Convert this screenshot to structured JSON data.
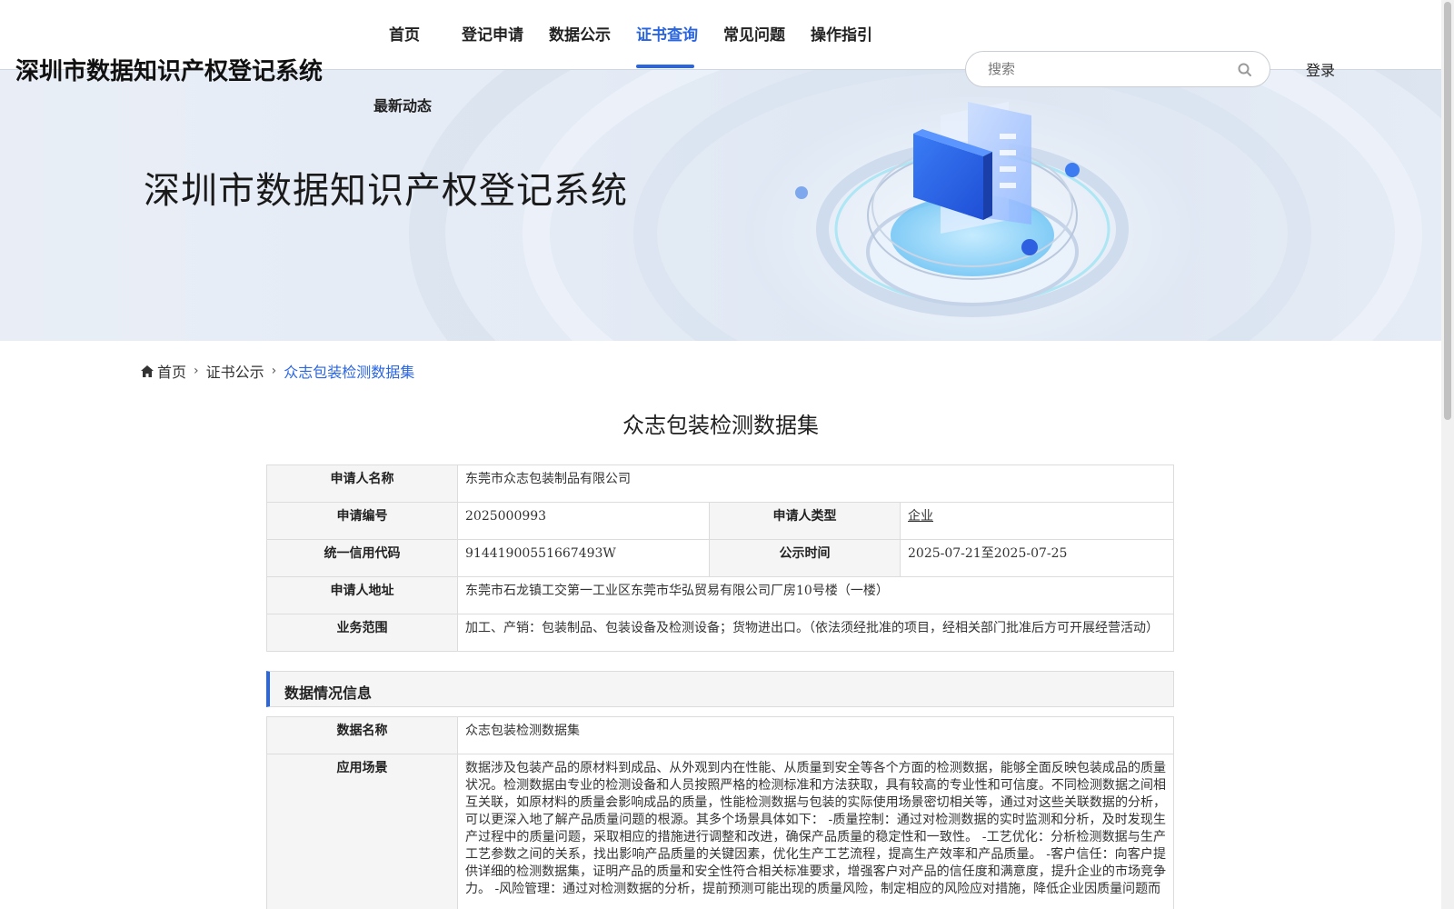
{
  "header": {
    "site_title": "深圳市数据知识产权登记系统",
    "nav": [
      {
        "label": "首页"
      },
      {
        "label": "登记申请"
      },
      {
        "label": "数据公示"
      },
      {
        "label": "证书查询",
        "active": true
      },
      {
        "label": "常见问题"
      },
      {
        "label": "操作指引"
      }
    ],
    "nav_second_row": "最新动态",
    "search_placeholder": "搜索",
    "login_label": "登录",
    "accent_color": "#2a66e0"
  },
  "banner": {
    "title": "深圳市数据知识产权登记系统"
  },
  "breadcrumb": {
    "home": "首页",
    "level2": "证书公示",
    "current": "众志包装检测数据集"
  },
  "page_title": "众志包装检测数据集",
  "applicant": {
    "name_label": "申请人名称",
    "name_value": "东莞市众志包装制品有限公司",
    "number_label": "申请编号",
    "number_value": "2025000993",
    "type_label": "申请人类型",
    "type_value": "企业",
    "credit_label": "统一信用代码",
    "credit_value": "91441900551667493W",
    "publish_label": "公示时间",
    "publish_value": "2025-07-21至2025-07-25",
    "address_label": "申请人地址",
    "address_value": "东莞市石龙镇工交第一工业区东莞市华弘贸易有限公司厂房10号楼（一楼）",
    "scope_label": "业务范围",
    "scope_value": "加工、产销：包装制品、包装设备及检测设备；货物进出口。（依法须经批准的项目，经相关部门批准后方可开展经营活动）"
  },
  "data_section": {
    "heading": "数据情况信息",
    "data_name_label": "数据名称",
    "data_name_value": "众志包装检测数据集",
    "scenario_label": "应用场景",
    "scenario_value": "数据涉及包装产品的原材料到成品、从外观到内在性能、从质量到安全等各个方面的检测数据，能够全面反映包装成品的质量状况。检测数据由专业的检测设备和人员按照严格的检测标准和方法获取，具有较高的专业性和可信度。不同检测数据之间相互关联，如原材料的质量会影响成品的质量，性能检测数据与包装的实际使用场景密切相关等，通过对这些关联数据的分析，可以更深入地了解产品质量问题的根源。其多个场景具体如下： -质量控制：通过对检测数据的实时监测和分析，及时发现生产过程中的质量问题，采取相应的措施进行调整和改进，确保产品质量的稳定性和一致性。 -工艺优化：分析检测数据与生产工艺参数之间的关系，找出影响产品质量的关键因素，优化生产工艺流程，提高生产效率和产品质量。 -客户信任：向客户提供详细的检测数据集，证明产品的质量和安全性符合相关标准要求，增强客户对产品的信任度和满意度，提升企业的市场竞争力。 -风险管理：通过对检测数据的分析，提前预测可能出现的质量风险，制定相应的风险应对措施，降低企业因质量问题而"
  }
}
